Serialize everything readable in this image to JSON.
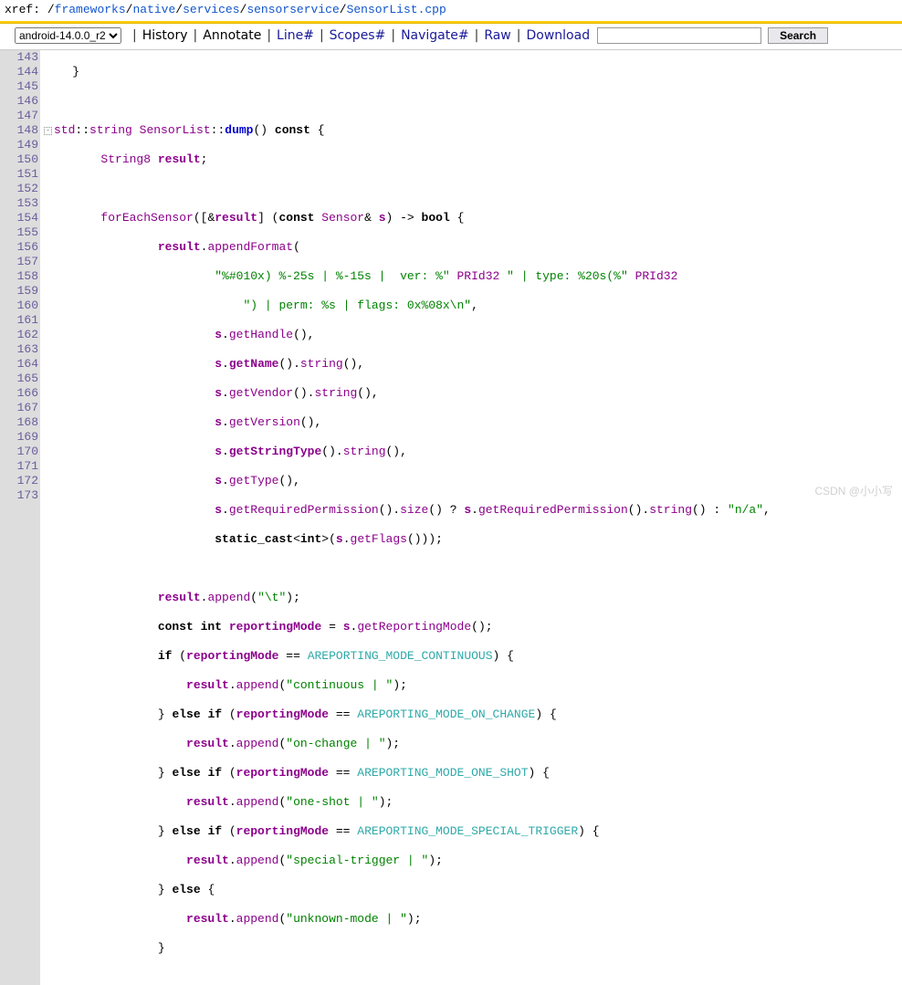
{
  "breadcrumb": {
    "prefix": "xref",
    "sep": ": ",
    "parts": [
      "frameworks",
      "native",
      "services",
      "sensorservice",
      "SensorList.cpp"
    ]
  },
  "toolbar": {
    "version": "android-14.0.0_r2",
    "history": "History",
    "annotate": "Annotate",
    "line": "Line#",
    "scopes": "Scopes#",
    "navigate": "Navigate#",
    "raw": "Raw",
    "download": "Download",
    "search": "Search",
    "search_placeholder": ""
  },
  "lines": {
    "start": 143,
    "end": 173,
    "nums": [
      "143",
      "144",
      "145",
      "146",
      "147",
      "148",
      "149",
      "150",
      "151",
      "152",
      "153",
      "154",
      "155",
      "156",
      "157",
      "158",
      "159",
      "160",
      "161",
      "162",
      "163",
      "164",
      "165",
      "166",
      "167",
      "168",
      "169",
      "170",
      "171",
      "172",
      "173"
    ]
  },
  "code": {
    "l143": "}",
    "l145_std": "std",
    "l145_string": "string",
    "l145_class": "SensorList",
    "l145_dump": "dump",
    "l145_const": "const",
    "l146_type": "String8",
    "l146_result": "result",
    "l148_fn": "forEachSensor",
    "l148_result": "result",
    "l148_const": "const",
    "l148_sensor": "Sensor",
    "l148_s": "s",
    "l148_bool": "bool",
    "l149_result": "result",
    "l149_append": "appendFormat",
    "l150_str": "\"%#010x) %-25s | %-15s |  ver: %\"",
    "l150_p": "PRId32",
    "l150_str2": "\" | type: %20s(%\"",
    "l150_p2": "PRId32",
    "l151_str": "\") | perm: %s | flags: 0x%08x\\n\"",
    "l152_s": "s",
    "l152_m": "getHandle",
    "l153_s": "s",
    "l153_m": "getName",
    "l153_m2": "string",
    "l154_s": "s",
    "l154_m": "getVendor",
    "l154_m2": "string",
    "l155_s": "s",
    "l155_m": "getVersion",
    "l156_s": "s",
    "l156_m": "getStringType",
    "l156_m2": "string",
    "l157_s": "s",
    "l157_m": "getType",
    "l158_s": "s",
    "l158_m": "getRequiredPermission",
    "l158_m2": "size",
    "l158_s2": "s",
    "l158_m3": "getRequiredPermission",
    "l158_m4": "string",
    "l158_na": "\"n/a\"",
    "l159_sc": "static_cast",
    "l159_int": "int",
    "l159_s": "s",
    "l159_m": "getFlags",
    "l161_r": "result",
    "l161_a": "append",
    "l161_s": "\"\\t\"",
    "l162_ci": "const int",
    "l162_rm": "reportingMode",
    "l162_s": "s",
    "l162_m": "getReportingMode",
    "l163_if": "if",
    "l163_rm": "reportingMode",
    "l163_c": "AREPORTING_MODE_CONTINUOUS",
    "l164_r": "result",
    "l164_a": "append",
    "l164_s": "\"continuous | \"",
    "l165_e": "else if",
    "l165_rm": "reportingMode",
    "l165_c": "AREPORTING_MODE_ON_CHANGE",
    "l166_r": "result",
    "l166_a": "append",
    "l166_s": "\"on-change | \"",
    "l167_e": "else if",
    "l167_rm": "reportingMode",
    "l167_c": "AREPORTING_MODE_ONE_SHOT",
    "l168_r": "result",
    "l168_a": "append",
    "l168_s": "\"one-shot | \"",
    "l169_e": "else if",
    "l169_rm": "reportingMode",
    "l169_c": "AREPORTING_MODE_SPECIAL_TRIGGER",
    "l170_r": "result",
    "l170_a": "append",
    "l170_s": "\"special-trigger | \"",
    "l171_e": "else",
    "l172_r": "result",
    "l172_a": "append",
    "l172_s": "\"unknown-mode | \""
  },
  "watermark": "CSDN @小小写"
}
